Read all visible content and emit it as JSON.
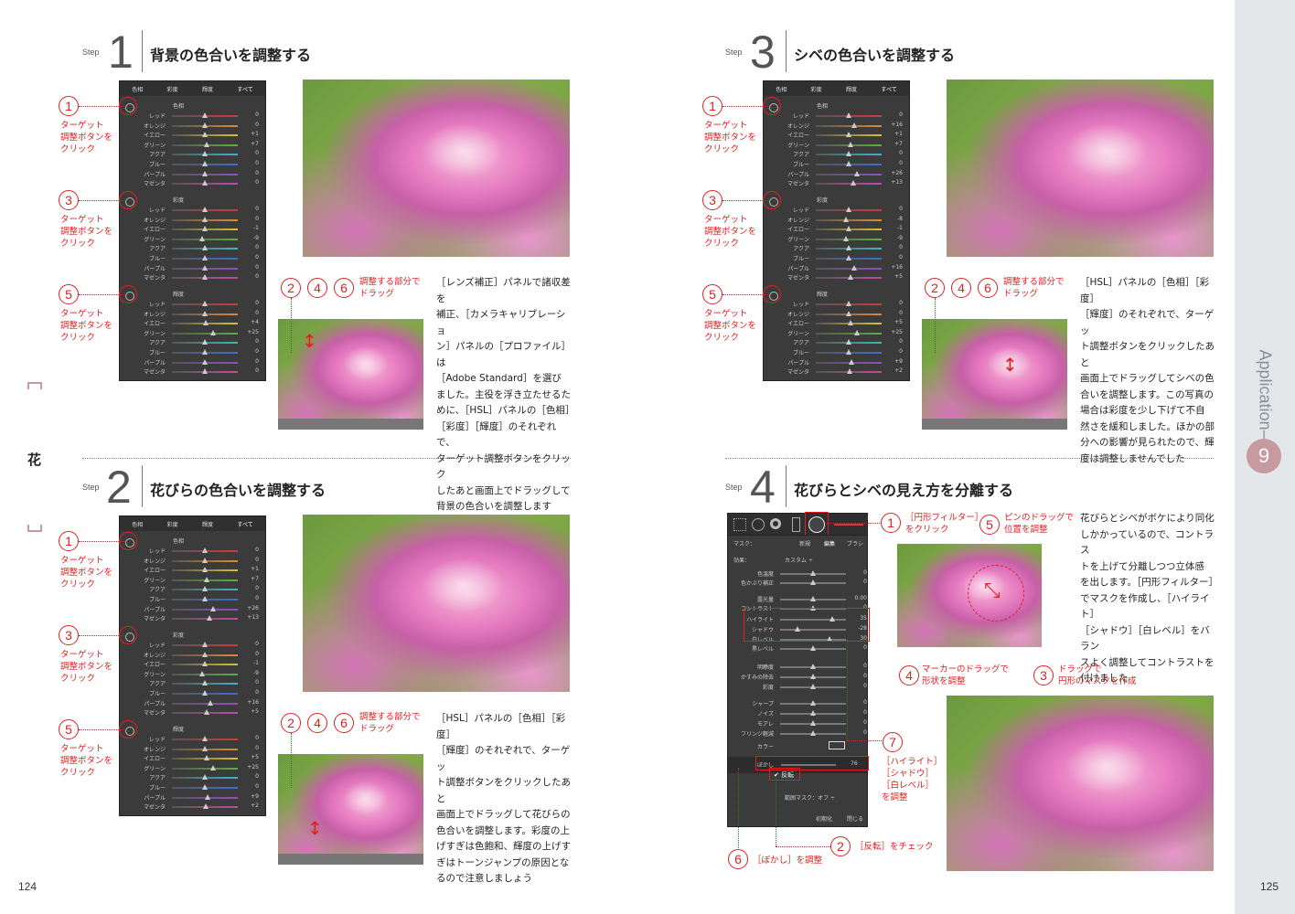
{
  "pages": {
    "left": "124",
    "right": "125"
  },
  "margin_char": "花",
  "sidebar": {
    "label": "Application—",
    "badge": "9",
    "color": "#c79aa0"
  },
  "step_word": "Step",
  "hsl_panel": {
    "tabs": [
      "色相",
      "彩度",
      "輝度",
      "すべて"
    ],
    "sections": [
      "色相",
      "彩度",
      "輝度"
    ],
    "rows": [
      "レッド",
      "オレンジ",
      "イエロー",
      "グリーン",
      "アクア",
      "ブルー",
      "パープル",
      "マゼンタ"
    ],
    "track_colors": [
      "#d03a3a",
      "#e08a32",
      "#d8c233",
      "#5ab040",
      "#3cb7c0",
      "#3b6fd0",
      "#9050c0",
      "#c04aa0"
    ]
  },
  "callouts": {
    "target": [
      "ターゲット",
      "調整ボタンを",
      "クリック"
    ],
    "drag": [
      "調整する部分で",
      "ドラッグ"
    ],
    "n1": "1",
    "n2": "2",
    "n3": "3",
    "n4": "4",
    "n5": "5",
    "n6": "6",
    "n7": "7"
  },
  "step1": {
    "num": "1",
    "title": "背景の色合いを調整する",
    "values": {
      "hue": [
        "0",
        "0",
        "+1",
        "+7",
        "0",
        "0",
        "0",
        "0"
      ],
      "sat": [
        "0",
        "0",
        "-1",
        "-9",
        "0",
        "0",
        "0",
        "0"
      ],
      "lum": [
        "0",
        "0",
        "+4",
        "+25",
        "0",
        "0",
        "0",
        "0"
      ]
    },
    "text": [
      "［レンズ補正］パネルで諸収差を",
      "補正、［カメラキャリブレーショ",
      "ン］パネルの［プロファイル］は",
      "［Adobe Standard］を選び",
      "ました。主役を浮き立たせるた",
      "めに、［HSL］パネルの［色相］",
      "［彩度］［輝度］のそれぞれで、",
      "ターゲット調整ボタンをクリック",
      "したあと画面上でドラッグして",
      "背景の色合いを調整します"
    ]
  },
  "step2": {
    "num": "2",
    "title": "花びらの色合いを調整する",
    "values": {
      "hue": [
        "0",
        "0",
        "+1",
        "+7",
        "0",
        "0",
        "+26",
        "+13"
      ],
      "sat": [
        "0",
        "0",
        "-1",
        "-9",
        "0",
        "0",
        "+16",
        "+5"
      ],
      "lum": [
        "0",
        "0",
        "+5",
        "+25",
        "0",
        "0",
        "+9",
        "+2"
      ]
    },
    "text": [
      "［HSL］パネルの［色相］［彩度］",
      "［輝度］のそれぞれで、ターゲッ",
      "ト調整ボタンをクリックしたあと",
      "画面上でドラッグして花びらの",
      "色合いを調整します。彩度の上",
      "げすぎは色飽和、輝度の上げす",
      "ぎはトーンジャンプの原因とな",
      "るので注意しましょう"
    ]
  },
  "step3": {
    "num": "3",
    "title": "シベの色合いを調整する",
    "values": {
      "hue": [
        "0",
        "+16",
        "+1",
        "+7",
        "0",
        "0",
        "+26",
        "+13"
      ],
      "sat": [
        "0",
        "-8",
        "-1",
        "-9",
        "0",
        "0",
        "+16",
        "+5"
      ],
      "lum": [
        "0",
        "0",
        "+5",
        "+25",
        "0",
        "0",
        "+9",
        "+2"
      ]
    },
    "text": [
      "［HSL］パネルの［色相］［彩度］",
      "［輝度］のそれぞれで、ターゲッ",
      "ト調整ボタンをクリックしたあと",
      "画面上でドラッグしてシベの色",
      "合いを調整します。この写真の",
      "場合は彩度を少し下げて不自",
      "然さを緩和しました。ほかの部",
      "分への影響が見られたので、輝",
      "度は調整しませんでした"
    ]
  },
  "step4": {
    "num": "4",
    "title": "花びらとシベの見え方を分離する",
    "panel": {
      "mask": "マスク：",
      "mask_opts": [
        "新規",
        "編集",
        "ブラシ"
      ],
      "effect": "効果：",
      "custom": "カスタム ÷",
      "rows": [
        {
          "l": "色温度",
          "v": "0"
        },
        {
          "l": "色かぶり補正",
          "v": "0"
        },
        {
          "l": "露光量",
          "v": "0.00"
        },
        {
          "l": "コントラスト",
          "v": "0"
        },
        {
          "l": "ハイライト",
          "v": "35"
        },
        {
          "l": "シャドウ",
          "v": "-28"
        },
        {
          "l": "白レベル",
          "v": "30"
        },
        {
          "l": "黒レベル",
          "v": "0"
        },
        {
          "l": "明瞭度",
          "v": "0"
        },
        {
          "l": "かすみの除去",
          "v": "0"
        },
        {
          "l": "彩度",
          "v": "0"
        },
        {
          "l": "シャープ",
          "v": "0"
        },
        {
          "l": "ノイズ",
          "v": "0"
        },
        {
          "l": "モアレ",
          "v": "0"
        },
        {
          "l": "フリンジ軽減",
          "v": "0"
        }
      ],
      "color": "カラー",
      "feather_label": "ぼかし",
      "feather_value": "76",
      "invert": "反転",
      "range_mask": "範囲マスク：オフ ÷",
      "reset": "初期化",
      "close": "閉じる"
    },
    "notes": {
      "c1": [
        "［円形フィルター］",
        "をクリック"
      ],
      "c5": [
        "ピンのドラッグで",
        "位置を調整"
      ],
      "c4": [
        "マーカーのドラッグで",
        "形状を調整"
      ],
      "c3": [
        "ドラッグで",
        "円形のマスクを作成"
      ],
      "c7": [
        "［ハイライト］",
        "［シャドウ］",
        "［白レベル］",
        "を調整"
      ],
      "c2": "［反転］をチェック",
      "c6": "［ぼかし］を調整"
    },
    "text": [
      "花びらとシベがボケにより同化",
      "しかかっているので、コントラス",
      "トを上げて分離しつつ立体感",
      "を出します。［円形フィルター］",
      "でマスクを作成し、［ハイライト］",
      "［シャドウ］［白レベル］をバラン",
      "スよく調整してコントラストを",
      "付けました"
    ]
  }
}
